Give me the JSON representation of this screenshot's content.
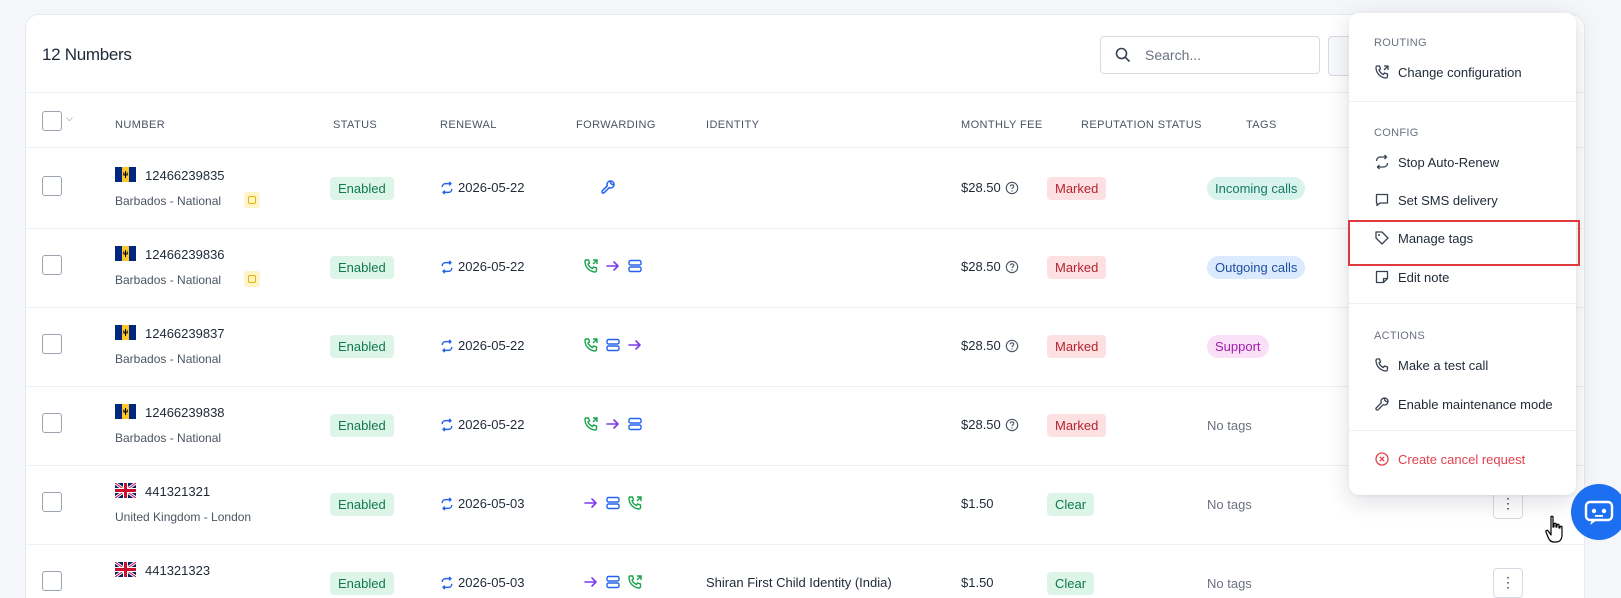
{
  "header": {
    "title": "12 Numbers"
  },
  "search": {
    "placeholder": "Search..."
  },
  "columns": [
    "NUMBER",
    "STATUS",
    "RENEWAL",
    "FORWARDING",
    "IDENTITY",
    "MONTHLY FEE",
    "REPUTATION STATUS",
    "TAGS"
  ],
  "rows": [
    {
      "flag": "barbados",
      "number": "12466239835",
      "location": "Barbados - National",
      "has_note": true,
      "status": "Enabled",
      "renewal": "2026-05-22",
      "forwarding": [
        "wrench"
      ],
      "identity": "",
      "fee": "$28.50",
      "reputation": "Marked",
      "tag": "Incoming calls"
    },
    {
      "flag": "barbados",
      "number": "12466239836",
      "location": "Barbados - National",
      "has_note": true,
      "status": "Enabled",
      "renewal": "2026-05-22",
      "forwarding": [
        "phone-forward",
        "arrow-right",
        "server"
      ],
      "identity": "",
      "fee": "$28.50",
      "reputation": "Marked",
      "tag": "Outgoing calls"
    },
    {
      "flag": "barbados",
      "number": "12466239837",
      "location": "Barbados - National",
      "has_note": false,
      "status": "Enabled",
      "renewal": "2026-05-22",
      "forwarding": [
        "phone-forward",
        "server",
        "arrow-right"
      ],
      "identity": "",
      "fee": "$28.50",
      "reputation": "Marked",
      "tag": "Support"
    },
    {
      "flag": "barbados",
      "number": "12466239838",
      "location": "Barbados - National",
      "has_note": false,
      "status": "Enabled",
      "renewal": "2026-05-22",
      "forwarding": [
        "phone-forward",
        "arrow-right",
        "server"
      ],
      "identity": "",
      "fee": "$28.50",
      "reputation": "Marked",
      "tag": "No tags"
    },
    {
      "flag": "uk",
      "number": "441321321",
      "location": "United Kingdom - London",
      "has_note": false,
      "status": "Enabled",
      "renewal": "2026-05-03",
      "forwarding": [
        "arrow-right",
        "server",
        "phone-forward"
      ],
      "identity": "",
      "fee": "$1.50",
      "reputation": "Clear",
      "tag": "No tags"
    },
    {
      "flag": "uk",
      "number": "441321323",
      "location": "",
      "has_note": false,
      "status": "Enabled",
      "renewal": "2026-05-03",
      "forwarding": [
        "arrow-right",
        "server",
        "phone-forward"
      ],
      "identity": "Shiran First Child Identity (India)",
      "fee": "$1.50",
      "reputation": "Clear",
      "tag": "No tags"
    }
  ],
  "menu": {
    "routing_label": "ROUTING",
    "change_config": "Change configuration",
    "config_label": "CONFIG",
    "stop_auto_renew": "Stop Auto-Renew",
    "set_sms_delivery": "Set SMS delivery",
    "manage_tags": "Manage tags",
    "edit_note": "Edit note",
    "actions_label": "ACTIONS",
    "make_test_call": "Make a test call",
    "enable_maintenance": "Enable maintenance mode",
    "create_cancel": "Create cancel request"
  },
  "colors": {
    "accent": "#1d6ff2",
    "danger": "#e0424d",
    "highlight": "#e03a3e"
  }
}
